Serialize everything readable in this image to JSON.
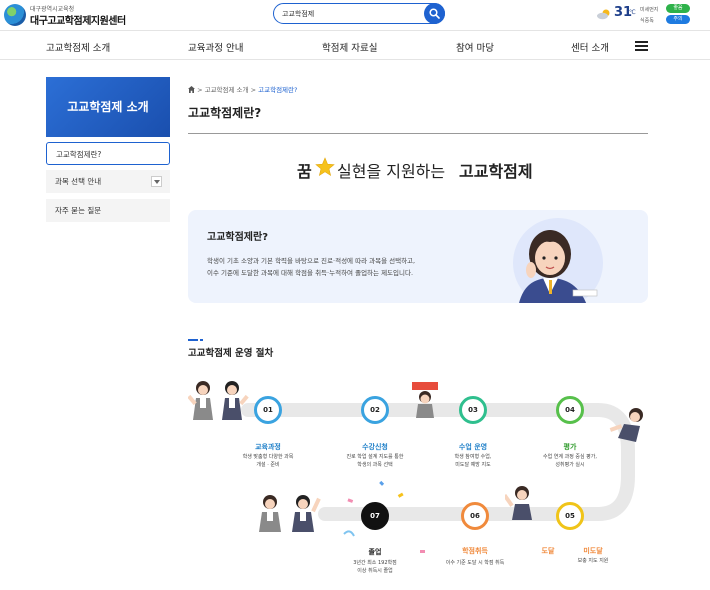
{
  "header": {
    "logo_small": "대구광역시교육청",
    "logo_big": "대구고교학점제지원센터",
    "search_value": "고교학점제",
    "weather": {
      "temp": "31",
      "unit": "℃"
    },
    "air": [
      {
        "label": "미세먼지",
        "badge": "좋음",
        "color": "#2eb24a"
      },
      {
        "label": "식중독",
        "badge": "주의",
        "color": "#1e7be0"
      }
    ]
  },
  "nav": [
    "고교학점제 소개",
    "교육과정 안내",
    "학점제 자료실",
    "참여 마당",
    "센터 소개"
  ],
  "sidebar": {
    "title": "고교학점제 소개",
    "items": [
      "고교학점제란?",
      "과목 선택 안내",
      "자주 묻는 질문"
    ]
  },
  "breadcrumb": [
    "고교학점제 소개",
    "고교학점제란?"
  ],
  "page_title": "고교학점제란?",
  "headline": {
    "a": "꿈",
    "b": "실현을 지원하는",
    "c": "고교학점제"
  },
  "intro": {
    "title": "고교학점제란?",
    "lines": [
      "학생이 기초 소양과 기본 학력을 바탕으로 진로·적성에 따라 과목을 선택하고,",
      "이수 기준에 도달한 과목에 대해 학점을 취득·누적하여 졸업하는 제도입니다."
    ]
  },
  "section_title": "고교학점제 운영 절차",
  "steps": [
    {
      "num": "01",
      "title": "교육과정",
      "desc": [
        "학생 맞춤형 다양한 과목",
        "개설 · 준비"
      ],
      "color": "#3aa3e0"
    },
    {
      "num": "02",
      "title": "수강신청",
      "desc": [
        "진로 학업 설계 지도를 통한",
        "학생의 과목 선택"
      ],
      "color": "#3aa3e0"
    },
    {
      "num": "03",
      "title": "수업 운영",
      "desc": [
        "학생 참여형 수업,",
        "미도달 예방 지도"
      ],
      "color": "#2fbf8e"
    },
    {
      "num": "04",
      "title": "평가",
      "desc": [
        "수업 연계 과정 중심 평가,",
        "성취평가 실시"
      ],
      "color": "#57c04b"
    },
    {
      "num": "05",
      "title": "",
      "desc": [],
      "color": "#f0c419"
    },
    {
      "num": "06",
      "title": "학점취득",
      "desc": [
        "이수 기준 도달 시 학점 취득"
      ],
      "color": "#f08a3c"
    },
    {
      "num": "07",
      "title": "졸업",
      "desc": [
        "3년간 최소 192학점",
        "이상 취득시 졸업"
      ],
      "color": "#111111"
    }
  ],
  "step05_branches": {
    "reach": "도달",
    "not_reach": "미도달",
    "not_reach_desc": "보충 지도 지원"
  }
}
